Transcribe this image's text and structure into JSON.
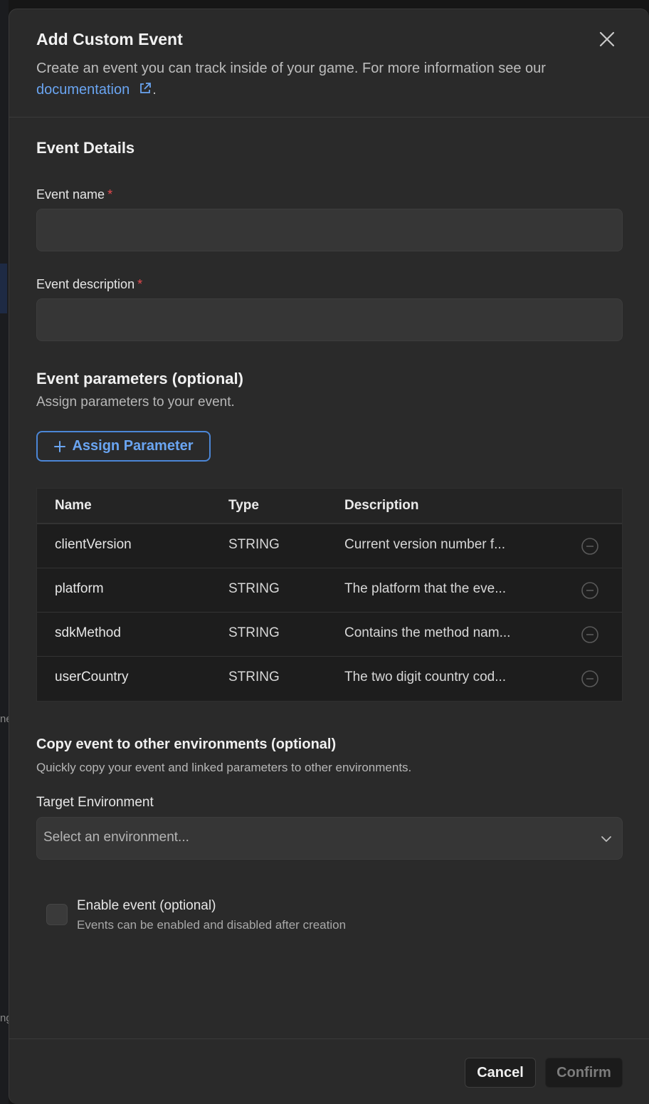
{
  "modal": {
    "title": "Add Custom Event",
    "subtitle_text": "Create an event you can track inside of your game. For more information see our",
    "doc_link_label": "documentation",
    "subtitle_end": "."
  },
  "event_details": {
    "section_title": "Event Details",
    "name_label": "Event name",
    "name_value": "",
    "description_label": "Event description",
    "description_value": "",
    "required_marker": "*"
  },
  "parameters": {
    "section_title": "Event parameters (optional)",
    "helper": "Assign parameters to your event.",
    "assign_label": "Assign Parameter",
    "columns": {
      "name": "Name",
      "type": "Type",
      "description": "Description"
    },
    "rows": [
      {
        "name": "clientVersion",
        "type": "STRING",
        "description": "Current version number f..."
      },
      {
        "name": "platform",
        "type": "STRING",
        "description": "The platform that the eve..."
      },
      {
        "name": "sdkMethod",
        "type": "STRING",
        "description": "Contains the method nam..."
      },
      {
        "name": "userCountry",
        "type": "STRING",
        "description": "The two digit country cod..."
      }
    ]
  },
  "copy": {
    "section_title": "Copy event to other environments (optional)",
    "helper": "Quickly copy your event and linked parameters to other environments.",
    "target_label": "Target Environment",
    "select_placeholder": "Select an environment..."
  },
  "enable": {
    "label": "Enable event (optional)",
    "helper": "Events can be enabled and disabled after creation",
    "checked": false
  },
  "footer": {
    "cancel_label": "Cancel",
    "confirm_label": "Confirm"
  },
  "background_fragments": {
    "frag_1": "ne",
    "frag_2": "ng"
  },
  "colors": {
    "accent": "#6aa5f2",
    "required": "#e5484d",
    "modal_bg": "#2a2a2a",
    "input_bg": "#363636"
  },
  "icons": {
    "close": "close-icon",
    "external_link": "external-link-icon",
    "plus": "plus-icon",
    "remove": "minus-circle-icon",
    "chevron": "chevron-down-icon"
  }
}
